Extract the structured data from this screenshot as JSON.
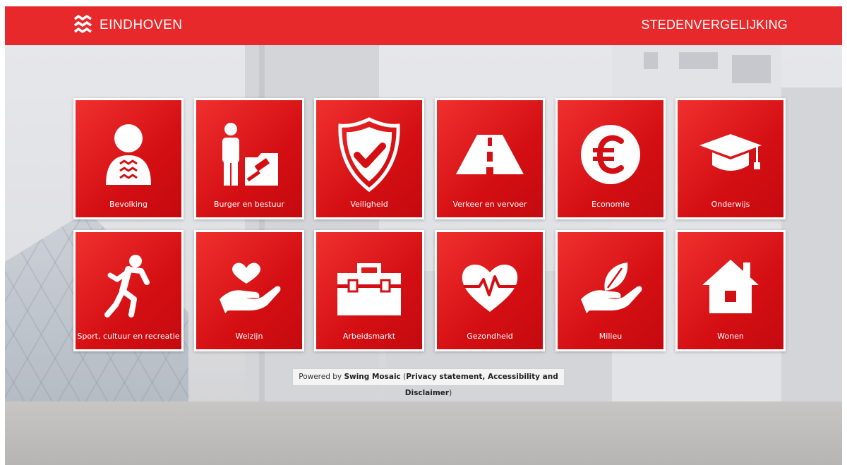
{
  "header": {
    "logo_text": "EINDHOVEN",
    "title": "STEDENVERGELIJKING"
  },
  "tiles": [
    {
      "label": "Bevolking",
      "icon": "person-icon"
    },
    {
      "label": "Burger en bestuur",
      "icon": "person-gavel-icon"
    },
    {
      "label": "Veiligheid",
      "icon": "shield-check-icon"
    },
    {
      "label": "Verkeer en vervoer",
      "icon": "road-icon"
    },
    {
      "label": "Economie",
      "icon": "euro-icon"
    },
    {
      "label": "Onderwijs",
      "icon": "graduation-cap-icon"
    },
    {
      "label": "Sport, cultuur en recreatie",
      "icon": "runner-icon"
    },
    {
      "label": "Welzijn",
      "icon": "hand-heart-icon"
    },
    {
      "label": "Arbeidsmarkt",
      "icon": "toolbox-icon"
    },
    {
      "label": "Gezondheid",
      "icon": "heart-pulse-icon"
    },
    {
      "label": "Milieu",
      "icon": "hand-leaf-icon"
    },
    {
      "label": "Wonen",
      "icon": "house-icon"
    }
  ],
  "footer": {
    "prefix": "Powered by ",
    "brand": "Swing Mosaic",
    "open": "  (",
    "links": "Privacy statement, Accessibility and Disclaimer",
    "close": ")"
  },
  "colors": {
    "brand_red": "#e8292b",
    "tile_red": "#d40f13"
  }
}
